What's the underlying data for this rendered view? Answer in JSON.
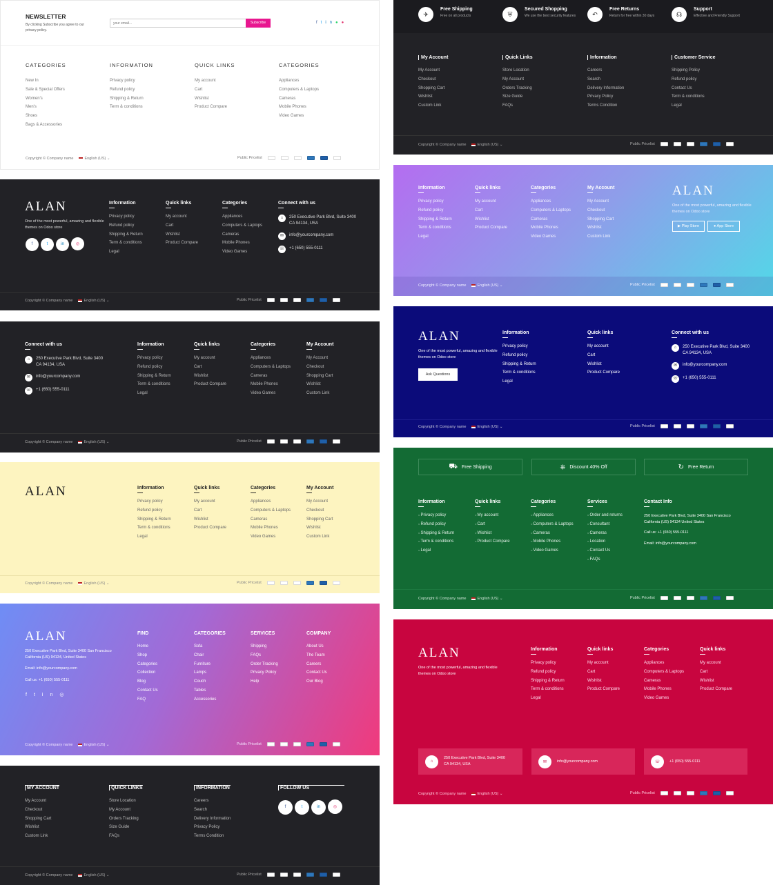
{
  "common": {
    "copyright": "Copyright © Company name",
    "language": "English (US)",
    "pricelist": "Public Pricelist",
    "caret": "⌄"
  },
  "p1": {
    "title": "NEWSLETTER",
    "desc": "By clicking Subscribe you agree to our privacy policy.",
    "placeholder": "your email...",
    "btn": "Subscribe",
    "cols": [
      {
        "title": "CATEGORIES",
        "items": [
          "New In",
          "Sale & Special Offers",
          "Women's",
          "Men's",
          "Shoes",
          "Bags & Accessories"
        ]
      },
      {
        "title": "INFORMATION",
        "items": [
          "Privacy policy",
          "Refund policy",
          "Shipping & Return",
          "Term & conditions"
        ]
      },
      {
        "title": "QUICK LINKS",
        "items": [
          "My account",
          "Cart",
          "Wishlist",
          "Product Compare"
        ]
      },
      {
        "title": "CATEGORIES",
        "items": [
          "Appliances",
          "Computers & Laptops",
          "Cameras",
          "Mobile Phones",
          "Video Games"
        ]
      }
    ]
  },
  "p2": {
    "logo": "ALAN",
    "tagline": "One of the most powerful, amazing and flexible themes on Odoo store",
    "cols": [
      {
        "title": "Information",
        "items": [
          "Privacy policy",
          "Refund policy",
          "Shipping & Return",
          "Term & conditions",
          "Legal"
        ]
      },
      {
        "title": "Quick links",
        "items": [
          "My account",
          "Cart",
          "Wishlist",
          "Product Compare"
        ]
      },
      {
        "title": "Categories",
        "items": [
          "Appliances",
          "Computers & Laptops",
          "Cameras",
          "Mobile Phones",
          "Video Games"
        ]
      }
    ],
    "contact_title": "Connect with us",
    "address": "250 Executive Park Blvd, Suite 3400 CA 94134, USA",
    "email": "info@yourcompany.com",
    "phone": "+1 (650) 555-0111"
  },
  "p3": {
    "contact_title": "Connect with us",
    "address": "250 Executive Park Blvd, Suite 3400 CA 94134, USA",
    "email": "info@yourcompany.com",
    "phone": "+1 (650) 555-0111",
    "cols": [
      {
        "title": "Information",
        "items": [
          "Privacy policy",
          "Refund policy",
          "Shipping & Return",
          "Term & conditions",
          "Legal"
        ]
      },
      {
        "title": "Quick links",
        "items": [
          "My account",
          "Cart",
          "Wishlist",
          "Product Compare"
        ]
      },
      {
        "title": "Categories",
        "items": [
          "Appliances",
          "Computers & Laptops",
          "Cameras",
          "Mobile Phones",
          "Video Games"
        ]
      },
      {
        "title": "My Account",
        "items": [
          "My Account",
          "Checkout",
          "Shopping Cart",
          "Wishlist",
          "Custom Link"
        ]
      }
    ]
  },
  "p4": {
    "logo": "ALAN",
    "cols": [
      {
        "title": "Information",
        "items": [
          "Privacy policy",
          "Refund policy",
          "Shipping & Return",
          "Term & conditions",
          "Legal"
        ]
      },
      {
        "title": "Quick links",
        "items": [
          "My account",
          "Cart",
          "Wishlist",
          "Product Compare"
        ]
      },
      {
        "title": "Categories",
        "items": [
          "Appliances",
          "Computers & Laptops",
          "Cameras",
          "Mobile Phones",
          "Video Games"
        ]
      },
      {
        "title": "My Account",
        "items": [
          "My Account",
          "Checkout",
          "Shopping Cart",
          "Wishlist",
          "Custom Link"
        ]
      }
    ]
  },
  "p5": {
    "logo": "ALAN",
    "address": "250 Executive Park Blvd, Suite 3400 San Francisco California (US) 94134, United States",
    "email": "Email: info@yourcompany.com",
    "phone": "Call us: +1 (650) 555-0111",
    "cols": [
      {
        "title": "FIND",
        "items": [
          "Home",
          "Shop",
          "Categories",
          "Collection",
          "Blog",
          "Contact Us",
          "FAQ"
        ]
      },
      {
        "title": "CATEGORIES",
        "items": [
          "Sofa",
          "Chair",
          "Furniture",
          "Lamps",
          "Couch",
          "Tables",
          "Accessories"
        ]
      },
      {
        "title": "SERVICES",
        "items": [
          "Shipping",
          "FAQs",
          "Order Tracking",
          "Privacy Policy",
          "Help"
        ]
      },
      {
        "title": "COMPANY",
        "items": [
          "About Us",
          "The Team",
          "Careers",
          "Contact Us",
          "Our Blog"
        ]
      }
    ]
  },
  "p6": {
    "cols": [
      {
        "title": "MY ACCOUNT",
        "items": [
          "My Account",
          "Checkout",
          "Shopping Cart",
          "Wishlist",
          "Custom Link"
        ]
      },
      {
        "title": "QUICK LINKS",
        "items": [
          "Store Location",
          "My Account",
          "Orders Tracking",
          "Size Guide",
          "FAQs"
        ]
      },
      {
        "title": "INFORMATION",
        "items": [
          "Careers",
          "Search",
          "Delivery Information",
          "Privacy Policy",
          "Terms Condition"
        ]
      }
    ],
    "follow_title": "FOLLOW US"
  },
  "r1": {
    "features": [
      {
        "title": "Free Shipping",
        "sub": "Free on all products"
      },
      {
        "title": "Secured Shopping",
        "sub": "We use the best security features"
      },
      {
        "title": "Free Returns",
        "sub": "Return for free within 30 days"
      },
      {
        "title": "Support",
        "sub": "Effective and Friendly Support"
      }
    ],
    "cols": [
      {
        "title": "My Account",
        "items": [
          "My Account",
          "Checkout",
          "Shopping Cart",
          "Wishlist",
          "Custom Link"
        ]
      },
      {
        "title": "Quick Links",
        "items": [
          "Store Location",
          "My Account",
          "Orders Tracking",
          "Size Guide",
          "FAQs"
        ]
      },
      {
        "title": "Information",
        "items": [
          "Careers",
          "Search",
          "Delivery Information",
          "Privacy Policy",
          "Terms Condition"
        ]
      },
      {
        "title": "Customer Service",
        "items": [
          "Shipping Policy",
          "Refund policy",
          "Contact Us",
          "Term & conditions",
          "Legal"
        ]
      }
    ]
  },
  "r2": {
    "logo": "ALAN",
    "tagline": "One of the most powerful, amazing and flexible themes on Odoo store",
    "play": "Play Store",
    "app": "App Store",
    "cols": [
      {
        "title": "Information",
        "items": [
          "Privacy policy",
          "Refund policy",
          "Shipping & Return",
          "Term & conditions",
          "Legal"
        ]
      },
      {
        "title": "Quick links",
        "items": [
          "My account",
          "Cart",
          "Wishlist",
          "Product Compare"
        ]
      },
      {
        "title": "Categories",
        "items": [
          "Appliances",
          "Computers & Laptops",
          "Cameras",
          "Mobile Phones",
          "Video Games"
        ]
      },
      {
        "title": "My Account",
        "items": [
          "My Account",
          "Checkout",
          "Shopping Cart",
          "Wishlist",
          "Custom Link"
        ]
      }
    ]
  },
  "r3": {
    "logo": "ALAN",
    "tagline": "One of the most powerful, amazing and flexible themes on Odoo store",
    "btn": "Ask Questions",
    "cols": [
      {
        "title": "Information",
        "items": [
          "Privacy policy",
          "Refund policy",
          "Shipping & Return",
          "Term & conditions",
          "Legal"
        ]
      },
      {
        "title": "Quick links",
        "items": [
          "My account",
          "Cart",
          "Wishlist",
          "Product Compare"
        ]
      }
    ],
    "contact_title": "Connect with us",
    "address": "250 Executive Park Blvd, Suite 3400 CA 94134, USA",
    "email": "info@yourcompany.com",
    "phone": "+1 (650) 555-0111"
  },
  "r4": {
    "features": [
      "Free Shipping",
      "Discount 40% Off",
      "Free Return"
    ],
    "cols": [
      {
        "title": "Information",
        "items": [
          "Privacy policy",
          "Refund policy",
          "Shipping & Return",
          "Term & conditions",
          "Legal"
        ]
      },
      {
        "title": "Quick links",
        "items": [
          "My account",
          "Cart",
          "Wishlist",
          "Product Compare"
        ]
      },
      {
        "title": "Categories",
        "items": [
          "Appliances",
          "Computers & Laptops",
          "Cameras",
          "Mobile Phones",
          "Video Games"
        ]
      },
      {
        "title": "Services",
        "items": [
          "Order and returns",
          "Consultant",
          "Cameras",
          "Location",
          "Contact Us",
          "FAQs"
        ]
      }
    ],
    "contact_title": "Contact Info",
    "address": "250 Executive Park Blvd, Suite 3400 San Francisco California (US) 94134 United States",
    "phone": "Call us: +1 (650) 555-0111",
    "email": "Email: info@yourcompany.com"
  },
  "r5": {
    "logo": "ALAN",
    "tagline": "One of the most powerful, amazing and flexible themes on Odoo store",
    "cols": [
      {
        "title": "Information",
        "items": [
          "Privacy policy",
          "Refund policy",
          "Shipping & Return",
          "Term & conditions",
          "Legal"
        ]
      },
      {
        "title": "Quick links",
        "items": [
          "My account",
          "Cart",
          "Wishlist",
          "Product Compare"
        ]
      },
      {
        "title": "Categories",
        "items": [
          "Appliances",
          "Computers & Laptops",
          "Cameras",
          "Mobile Phones",
          "Video Games"
        ]
      },
      {
        "title": "Quick links",
        "items": [
          "My account",
          "Cart",
          "Wishlist",
          "Product Compare"
        ]
      }
    ],
    "address": "250 Executive Park Blvd, Suite 3400 CA 94134, USA",
    "email": "info@yourcompany.com",
    "phone": "+1 (650) 555-0111"
  },
  "colors": {
    "dark": "#222226",
    "yellow": "#fdf4c0",
    "navy": "#0b0b7a",
    "green": "#136b34",
    "crimson": "#c8053f",
    "magenta": "#e8178f"
  }
}
